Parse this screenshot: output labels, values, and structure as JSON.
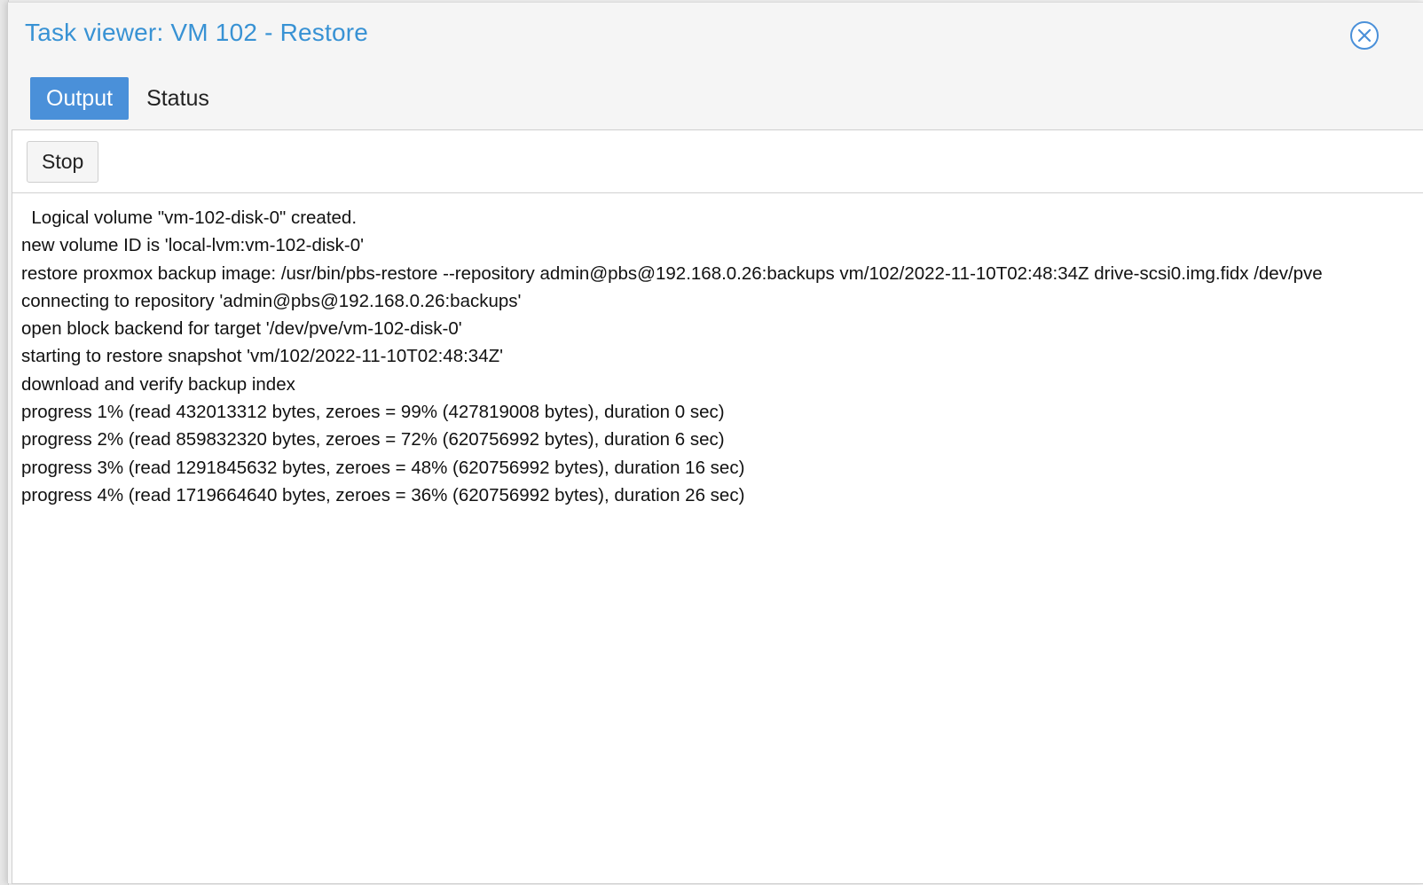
{
  "window": {
    "title": "Task viewer: VM 102 - Restore",
    "close_icon": "close-circle-icon"
  },
  "tabs": [
    {
      "label": "Output",
      "active": true
    },
    {
      "label": "Status",
      "active": false
    }
  ],
  "toolbar": {
    "stop_label": "Stop"
  },
  "log": {
    "lines": [
      "  Logical volume \"vm-102-disk-0\" created.",
      "new volume ID is 'local-lvm:vm-102-disk-0'",
      "restore proxmox backup image: /usr/bin/pbs-restore --repository admin@pbs@192.168.0.26:backups vm/102/2022-11-10T02:48:34Z drive-scsi0.img.fidx /dev/pve",
      "connecting to repository 'admin@pbs@192.168.0.26:backups'",
      "open block backend for target '/dev/pve/vm-102-disk-0'",
      "starting to restore snapshot 'vm/102/2022-11-10T02:48:34Z'",
      "download and verify backup index",
      "progress 1% (read 432013312 bytes, zeroes = 99% (427819008 bytes), duration 0 sec)",
      "progress 2% (read 859832320 bytes, zeroes = 72% (620756992 bytes), duration 6 sec)",
      "progress 3% (read 1291845632 bytes, zeroes = 48% (620756992 bytes), duration 16 sec)",
      "progress 4% (read 1719664640 bytes, zeroes = 36% (620756992 bytes), duration 26 sec)"
    ]
  },
  "colors": {
    "title": "#3892d4",
    "tab_active_bg": "#4a90d9",
    "close_icon": "#4a90d9"
  }
}
